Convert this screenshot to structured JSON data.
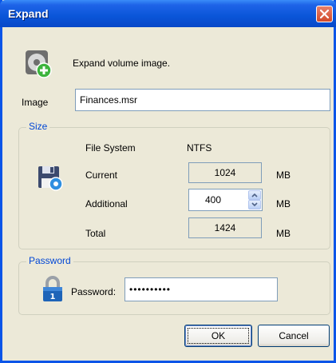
{
  "window": {
    "title": "Expand"
  },
  "header": {
    "description": "Expand volume image."
  },
  "image": {
    "label": "Image",
    "value": "Finances.msr"
  },
  "size": {
    "legend": "Size",
    "file_system_label": "File System",
    "file_system_value": "NTFS",
    "current_label": "Current",
    "current_value": "1024",
    "current_unit": "MB",
    "additional_label": "Additional",
    "additional_value": "400",
    "additional_unit": "MB",
    "total_label": "Total",
    "total_value": "1424",
    "total_unit": "MB"
  },
  "password": {
    "legend": "Password",
    "label": "Password:",
    "masked_value": "••••••••••"
  },
  "buttons": {
    "ok": "OK",
    "cancel": "Cancel"
  },
  "icons": {
    "header": "disk-image-add-icon",
    "size": "floppy-disk-icon",
    "password": "padlock-icon",
    "close": "close-icon"
  },
  "colors": {
    "titlebar": "#0A55D8",
    "window_bg": "#ECE9D8",
    "legend_text": "#0046D5",
    "close_button": "#D24A2A"
  }
}
